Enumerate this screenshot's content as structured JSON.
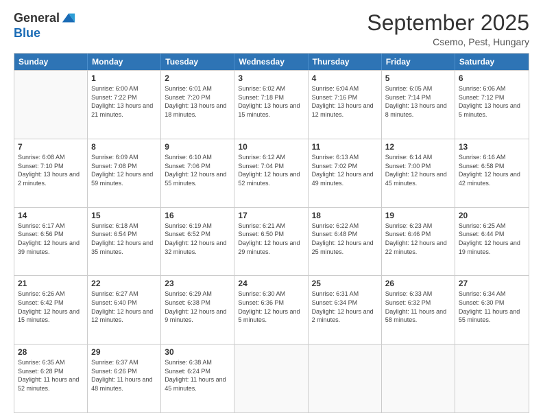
{
  "logo": {
    "general": "General",
    "blue": "Blue"
  },
  "header": {
    "month": "September 2025",
    "location": "Csemo, Pest, Hungary"
  },
  "weekdays": [
    "Sunday",
    "Monday",
    "Tuesday",
    "Wednesday",
    "Thursday",
    "Friday",
    "Saturday"
  ],
  "rows": [
    [
      {
        "day": "",
        "sunrise": "",
        "sunset": "",
        "daylight": ""
      },
      {
        "day": "1",
        "sunrise": "Sunrise: 6:00 AM",
        "sunset": "Sunset: 7:22 PM",
        "daylight": "Daylight: 13 hours and 21 minutes."
      },
      {
        "day": "2",
        "sunrise": "Sunrise: 6:01 AM",
        "sunset": "Sunset: 7:20 PM",
        "daylight": "Daylight: 13 hours and 18 minutes."
      },
      {
        "day": "3",
        "sunrise": "Sunrise: 6:02 AM",
        "sunset": "Sunset: 7:18 PM",
        "daylight": "Daylight: 13 hours and 15 minutes."
      },
      {
        "day": "4",
        "sunrise": "Sunrise: 6:04 AM",
        "sunset": "Sunset: 7:16 PM",
        "daylight": "Daylight: 13 hours and 12 minutes."
      },
      {
        "day": "5",
        "sunrise": "Sunrise: 6:05 AM",
        "sunset": "Sunset: 7:14 PM",
        "daylight": "Daylight: 13 hours and 8 minutes."
      },
      {
        "day": "6",
        "sunrise": "Sunrise: 6:06 AM",
        "sunset": "Sunset: 7:12 PM",
        "daylight": "Daylight: 13 hours and 5 minutes."
      }
    ],
    [
      {
        "day": "7",
        "sunrise": "Sunrise: 6:08 AM",
        "sunset": "Sunset: 7:10 PM",
        "daylight": "Daylight: 13 hours and 2 minutes."
      },
      {
        "day": "8",
        "sunrise": "Sunrise: 6:09 AM",
        "sunset": "Sunset: 7:08 PM",
        "daylight": "Daylight: 12 hours and 59 minutes."
      },
      {
        "day": "9",
        "sunrise": "Sunrise: 6:10 AM",
        "sunset": "Sunset: 7:06 PM",
        "daylight": "Daylight: 12 hours and 55 minutes."
      },
      {
        "day": "10",
        "sunrise": "Sunrise: 6:12 AM",
        "sunset": "Sunset: 7:04 PM",
        "daylight": "Daylight: 12 hours and 52 minutes."
      },
      {
        "day": "11",
        "sunrise": "Sunrise: 6:13 AM",
        "sunset": "Sunset: 7:02 PM",
        "daylight": "Daylight: 12 hours and 49 minutes."
      },
      {
        "day": "12",
        "sunrise": "Sunrise: 6:14 AM",
        "sunset": "Sunset: 7:00 PM",
        "daylight": "Daylight: 12 hours and 45 minutes."
      },
      {
        "day": "13",
        "sunrise": "Sunrise: 6:16 AM",
        "sunset": "Sunset: 6:58 PM",
        "daylight": "Daylight: 12 hours and 42 minutes."
      }
    ],
    [
      {
        "day": "14",
        "sunrise": "Sunrise: 6:17 AM",
        "sunset": "Sunset: 6:56 PM",
        "daylight": "Daylight: 12 hours and 39 minutes."
      },
      {
        "day": "15",
        "sunrise": "Sunrise: 6:18 AM",
        "sunset": "Sunset: 6:54 PM",
        "daylight": "Daylight: 12 hours and 35 minutes."
      },
      {
        "day": "16",
        "sunrise": "Sunrise: 6:19 AM",
        "sunset": "Sunset: 6:52 PM",
        "daylight": "Daylight: 12 hours and 32 minutes."
      },
      {
        "day": "17",
        "sunrise": "Sunrise: 6:21 AM",
        "sunset": "Sunset: 6:50 PM",
        "daylight": "Daylight: 12 hours and 29 minutes."
      },
      {
        "day": "18",
        "sunrise": "Sunrise: 6:22 AM",
        "sunset": "Sunset: 6:48 PM",
        "daylight": "Daylight: 12 hours and 25 minutes."
      },
      {
        "day": "19",
        "sunrise": "Sunrise: 6:23 AM",
        "sunset": "Sunset: 6:46 PM",
        "daylight": "Daylight: 12 hours and 22 minutes."
      },
      {
        "day": "20",
        "sunrise": "Sunrise: 6:25 AM",
        "sunset": "Sunset: 6:44 PM",
        "daylight": "Daylight: 12 hours and 19 minutes."
      }
    ],
    [
      {
        "day": "21",
        "sunrise": "Sunrise: 6:26 AM",
        "sunset": "Sunset: 6:42 PM",
        "daylight": "Daylight: 12 hours and 15 minutes."
      },
      {
        "day": "22",
        "sunrise": "Sunrise: 6:27 AM",
        "sunset": "Sunset: 6:40 PM",
        "daylight": "Daylight: 12 hours and 12 minutes."
      },
      {
        "day": "23",
        "sunrise": "Sunrise: 6:29 AM",
        "sunset": "Sunset: 6:38 PM",
        "daylight": "Daylight: 12 hours and 9 minutes."
      },
      {
        "day": "24",
        "sunrise": "Sunrise: 6:30 AM",
        "sunset": "Sunset: 6:36 PM",
        "daylight": "Daylight: 12 hours and 5 minutes."
      },
      {
        "day": "25",
        "sunrise": "Sunrise: 6:31 AM",
        "sunset": "Sunset: 6:34 PM",
        "daylight": "Daylight: 12 hours and 2 minutes."
      },
      {
        "day": "26",
        "sunrise": "Sunrise: 6:33 AM",
        "sunset": "Sunset: 6:32 PM",
        "daylight": "Daylight: 11 hours and 58 minutes."
      },
      {
        "day": "27",
        "sunrise": "Sunrise: 6:34 AM",
        "sunset": "Sunset: 6:30 PM",
        "daylight": "Daylight: 11 hours and 55 minutes."
      }
    ],
    [
      {
        "day": "28",
        "sunrise": "Sunrise: 6:35 AM",
        "sunset": "Sunset: 6:28 PM",
        "daylight": "Daylight: 11 hours and 52 minutes."
      },
      {
        "day": "29",
        "sunrise": "Sunrise: 6:37 AM",
        "sunset": "Sunset: 6:26 PM",
        "daylight": "Daylight: 11 hours and 48 minutes."
      },
      {
        "day": "30",
        "sunrise": "Sunrise: 6:38 AM",
        "sunset": "Sunset: 6:24 PM",
        "daylight": "Daylight: 11 hours and 45 minutes."
      },
      {
        "day": "",
        "sunrise": "",
        "sunset": "",
        "daylight": ""
      },
      {
        "day": "",
        "sunrise": "",
        "sunset": "",
        "daylight": ""
      },
      {
        "day": "",
        "sunrise": "",
        "sunset": "",
        "daylight": ""
      },
      {
        "day": "",
        "sunrise": "",
        "sunset": "",
        "daylight": ""
      }
    ]
  ]
}
